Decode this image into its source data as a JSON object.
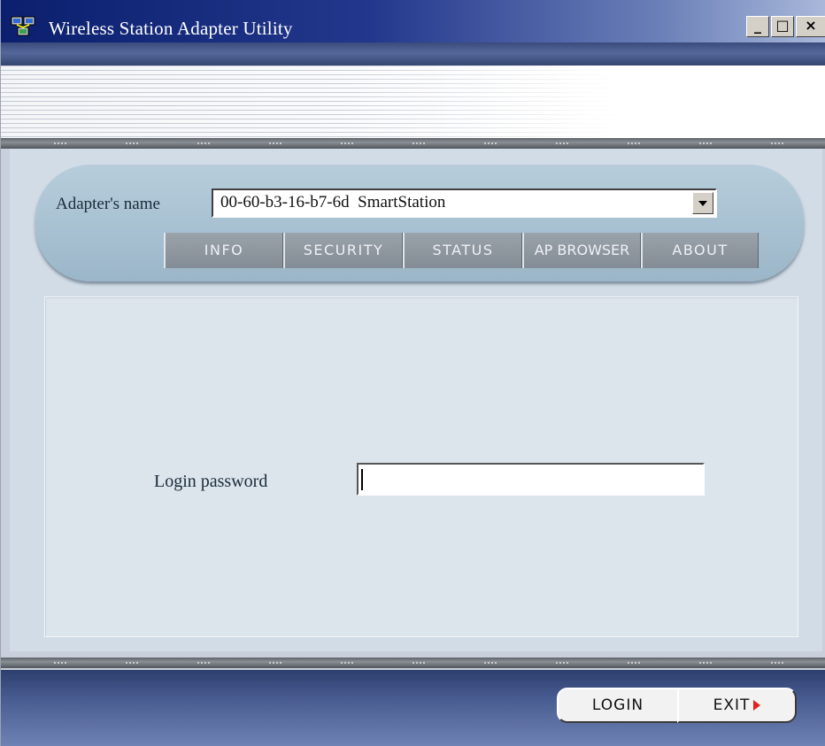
{
  "window": {
    "title": "Wireless Station Adapter Utility",
    "icon": "network-computer-icon",
    "controls": {
      "minimize": "_",
      "maximize": "□",
      "close": "×"
    }
  },
  "adapter": {
    "label": "Adapter's name",
    "selected": "00-60-b3-16-b7-6d  SmartStation"
  },
  "tabs": [
    {
      "label": "INFO"
    },
    {
      "label": "SECURITY"
    },
    {
      "label": "STATUS"
    },
    {
      "label": "AP BROWSER"
    },
    {
      "label": "ABOUT"
    }
  ],
  "login": {
    "label": "Login password",
    "value": ""
  },
  "footer": {
    "login_label": "LOGIN",
    "exit_label": "EXIT"
  },
  "colors": {
    "title_bar": "#0b1f6e",
    "tab_bg": "#8d959e",
    "panel_bg": "#dce5ec",
    "exit_arrow": "#e0231c"
  }
}
